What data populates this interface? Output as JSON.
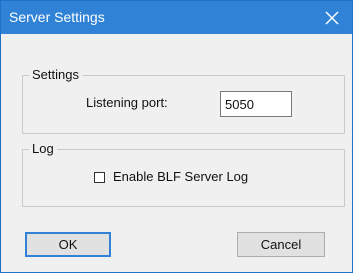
{
  "window": {
    "title": "Server Settings",
    "close_icon": "close-icon",
    "accent_color": "#2f82d6"
  },
  "settings_group": {
    "title": "Settings",
    "port_label": "Listening port:",
    "port_value": "5050"
  },
  "log_group": {
    "title": "Log",
    "enable_log_label": "Enable BLF Server Log",
    "enable_log_checked": false
  },
  "buttons": {
    "ok_label": "OK",
    "cancel_label": "Cancel"
  }
}
